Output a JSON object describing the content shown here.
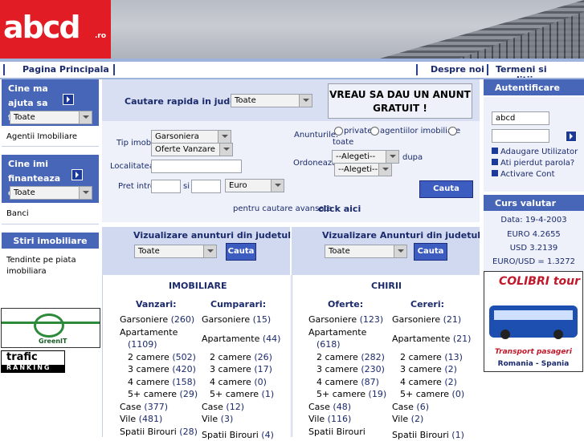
{
  "header": {
    "logo_text": "abcd",
    "logo_suffix": ".ro"
  },
  "nav": {
    "home": "Pagina Principala",
    "about": "Despre noi",
    "terms": "Termeni si conditii"
  },
  "left": {
    "help_title": "Cine ma ajuta sa fac tranzactia in",
    "help_select": "Toate",
    "help_item": "Agentii Imobiliare",
    "finance_title": "Cine imi finanteaza cumpararea in",
    "finance_select": "Toate",
    "finance_item": "Banci",
    "news_title": "Stiri imobiliare",
    "news_item": "Tendinte pe piata imobiliara",
    "greenit_label": "GreenIT",
    "trafic_label": "trafic",
    "ranking_label": "RANKING"
  },
  "search": {
    "quick_label": "Cautare rapida in judetul",
    "quick_select": "Toate",
    "anunt_button": "VREAU SA DAU UN ANUNT GRATUIT !",
    "tip_label": "Tip imobil:",
    "tip_select1": "Garsoniera",
    "tip_select2": "Oferte Vanzare",
    "loc_label": "Localitatea:",
    "pret_label": "Pret intre",
    "pret_si": "si",
    "currency": "Euro",
    "anunturi_label": "Anunturile:",
    "radio_private": "private",
    "radio_agentii": "agentiilor imobiliare",
    "radio_toate": "toate",
    "ordoneaza_label": "Ordoneaza",
    "ord_select1": "--Alegeti--",
    "ord_dupa": "dupa",
    "ord_select2": "--Alegeti--",
    "search_button": "Cauta",
    "advanced_text": "pentru cautare avansata",
    "advanced_link": "click aici"
  },
  "viz": {
    "left_title": "Vizualizare anunturi din judetul",
    "left_select": "Toate",
    "left_button": "Cauta",
    "right_title": "Vizualizare Anunturi din judetul",
    "right_select": "Toate",
    "right_button": "Cauta"
  },
  "imobiliare": {
    "title": "IMOBILIARE",
    "vanzari_header": "Vanzari:",
    "cumparari_header": "Cumparari:",
    "vanzari": [
      {
        "label": "Garsoniere",
        "count": "(260)"
      },
      {
        "label": "Apartamente",
        "count": ""
      },
      {
        "label": "",
        "count": "(1109)"
      },
      {
        "label": "2 camere",
        "count": "(502)"
      },
      {
        "label": "3 camere",
        "count": "(420)"
      },
      {
        "label": "4 camere",
        "count": "(158)"
      },
      {
        "label": "5+ camere",
        "count": "(29)"
      },
      {
        "label": "Case",
        "count": "(377)"
      },
      {
        "label": "Vile",
        "count": "(481)"
      },
      {
        "label": "Spatii Birouri",
        "count": "(28)"
      }
    ],
    "cumparari": [
      {
        "label": "Garsoniere",
        "count": "(15)"
      },
      {
        "label": "Apartamente",
        "count": "(44)"
      },
      {
        "label": "2 camere",
        "count": "(26)"
      },
      {
        "label": "3 camere",
        "count": "(17)"
      },
      {
        "label": "4 camere",
        "count": "(0)"
      },
      {
        "label": "5+ camere",
        "count": "(1)"
      },
      {
        "label": "Case",
        "count": "(12)"
      },
      {
        "label": "Vile",
        "count": "(3)"
      },
      {
        "label": "Spatii Birouri",
        "count": "(4)"
      }
    ]
  },
  "chirii": {
    "title": "CHIRII",
    "oferte_header": "Oferte:",
    "cereri_header": "Cereri:",
    "oferte": [
      {
        "label": "Garsoniere",
        "count": "(123)"
      },
      {
        "label": "Apartamente",
        "count": ""
      },
      {
        "label": "",
        "count": "(618)"
      },
      {
        "label": "2 camere",
        "count": "(282)"
      },
      {
        "label": "3 camere",
        "count": "(230)"
      },
      {
        "label": "4 camere",
        "count": "(87)"
      },
      {
        "label": "5+ camere",
        "count": "(19)"
      },
      {
        "label": "Case",
        "count": "(48)"
      },
      {
        "label": "Vile",
        "count": "(116)"
      },
      {
        "label": "Spatii Birouri",
        "count": ""
      }
    ],
    "cereri": [
      {
        "label": "Garsoniere",
        "count": "(21)"
      },
      {
        "label": "Apartamente",
        "count": "(21)"
      },
      {
        "label": "2 camere",
        "count": "(13)"
      },
      {
        "label": "3 camere",
        "count": "(2)"
      },
      {
        "label": "4 camere",
        "count": "(2)"
      },
      {
        "label": "5+ camere",
        "count": "(0)"
      },
      {
        "label": "Case",
        "count": "(6)"
      },
      {
        "label": "Vile",
        "count": "(2)"
      },
      {
        "label": "Spatii Birouri",
        "count": "(1)"
      }
    ]
  },
  "right": {
    "auth_title": "Autentificare",
    "username": "abcd",
    "add_user": "Adaugare Utilizator",
    "lost_pass": "Ati pierdut parola?",
    "activate": "Activare Cont",
    "curs_title": "Curs valutar",
    "curs_date": "Data: 19-4-2003",
    "curs_euro": "EURO 4.2655",
    "curs_usd": "USD 3.2139",
    "curs_ratio": "EURO/USD = 1.3272",
    "ad_brand": "COLIBRI tour",
    "ad_line1": "Transport pasageri",
    "ad_line2": "Romania - Spania"
  }
}
